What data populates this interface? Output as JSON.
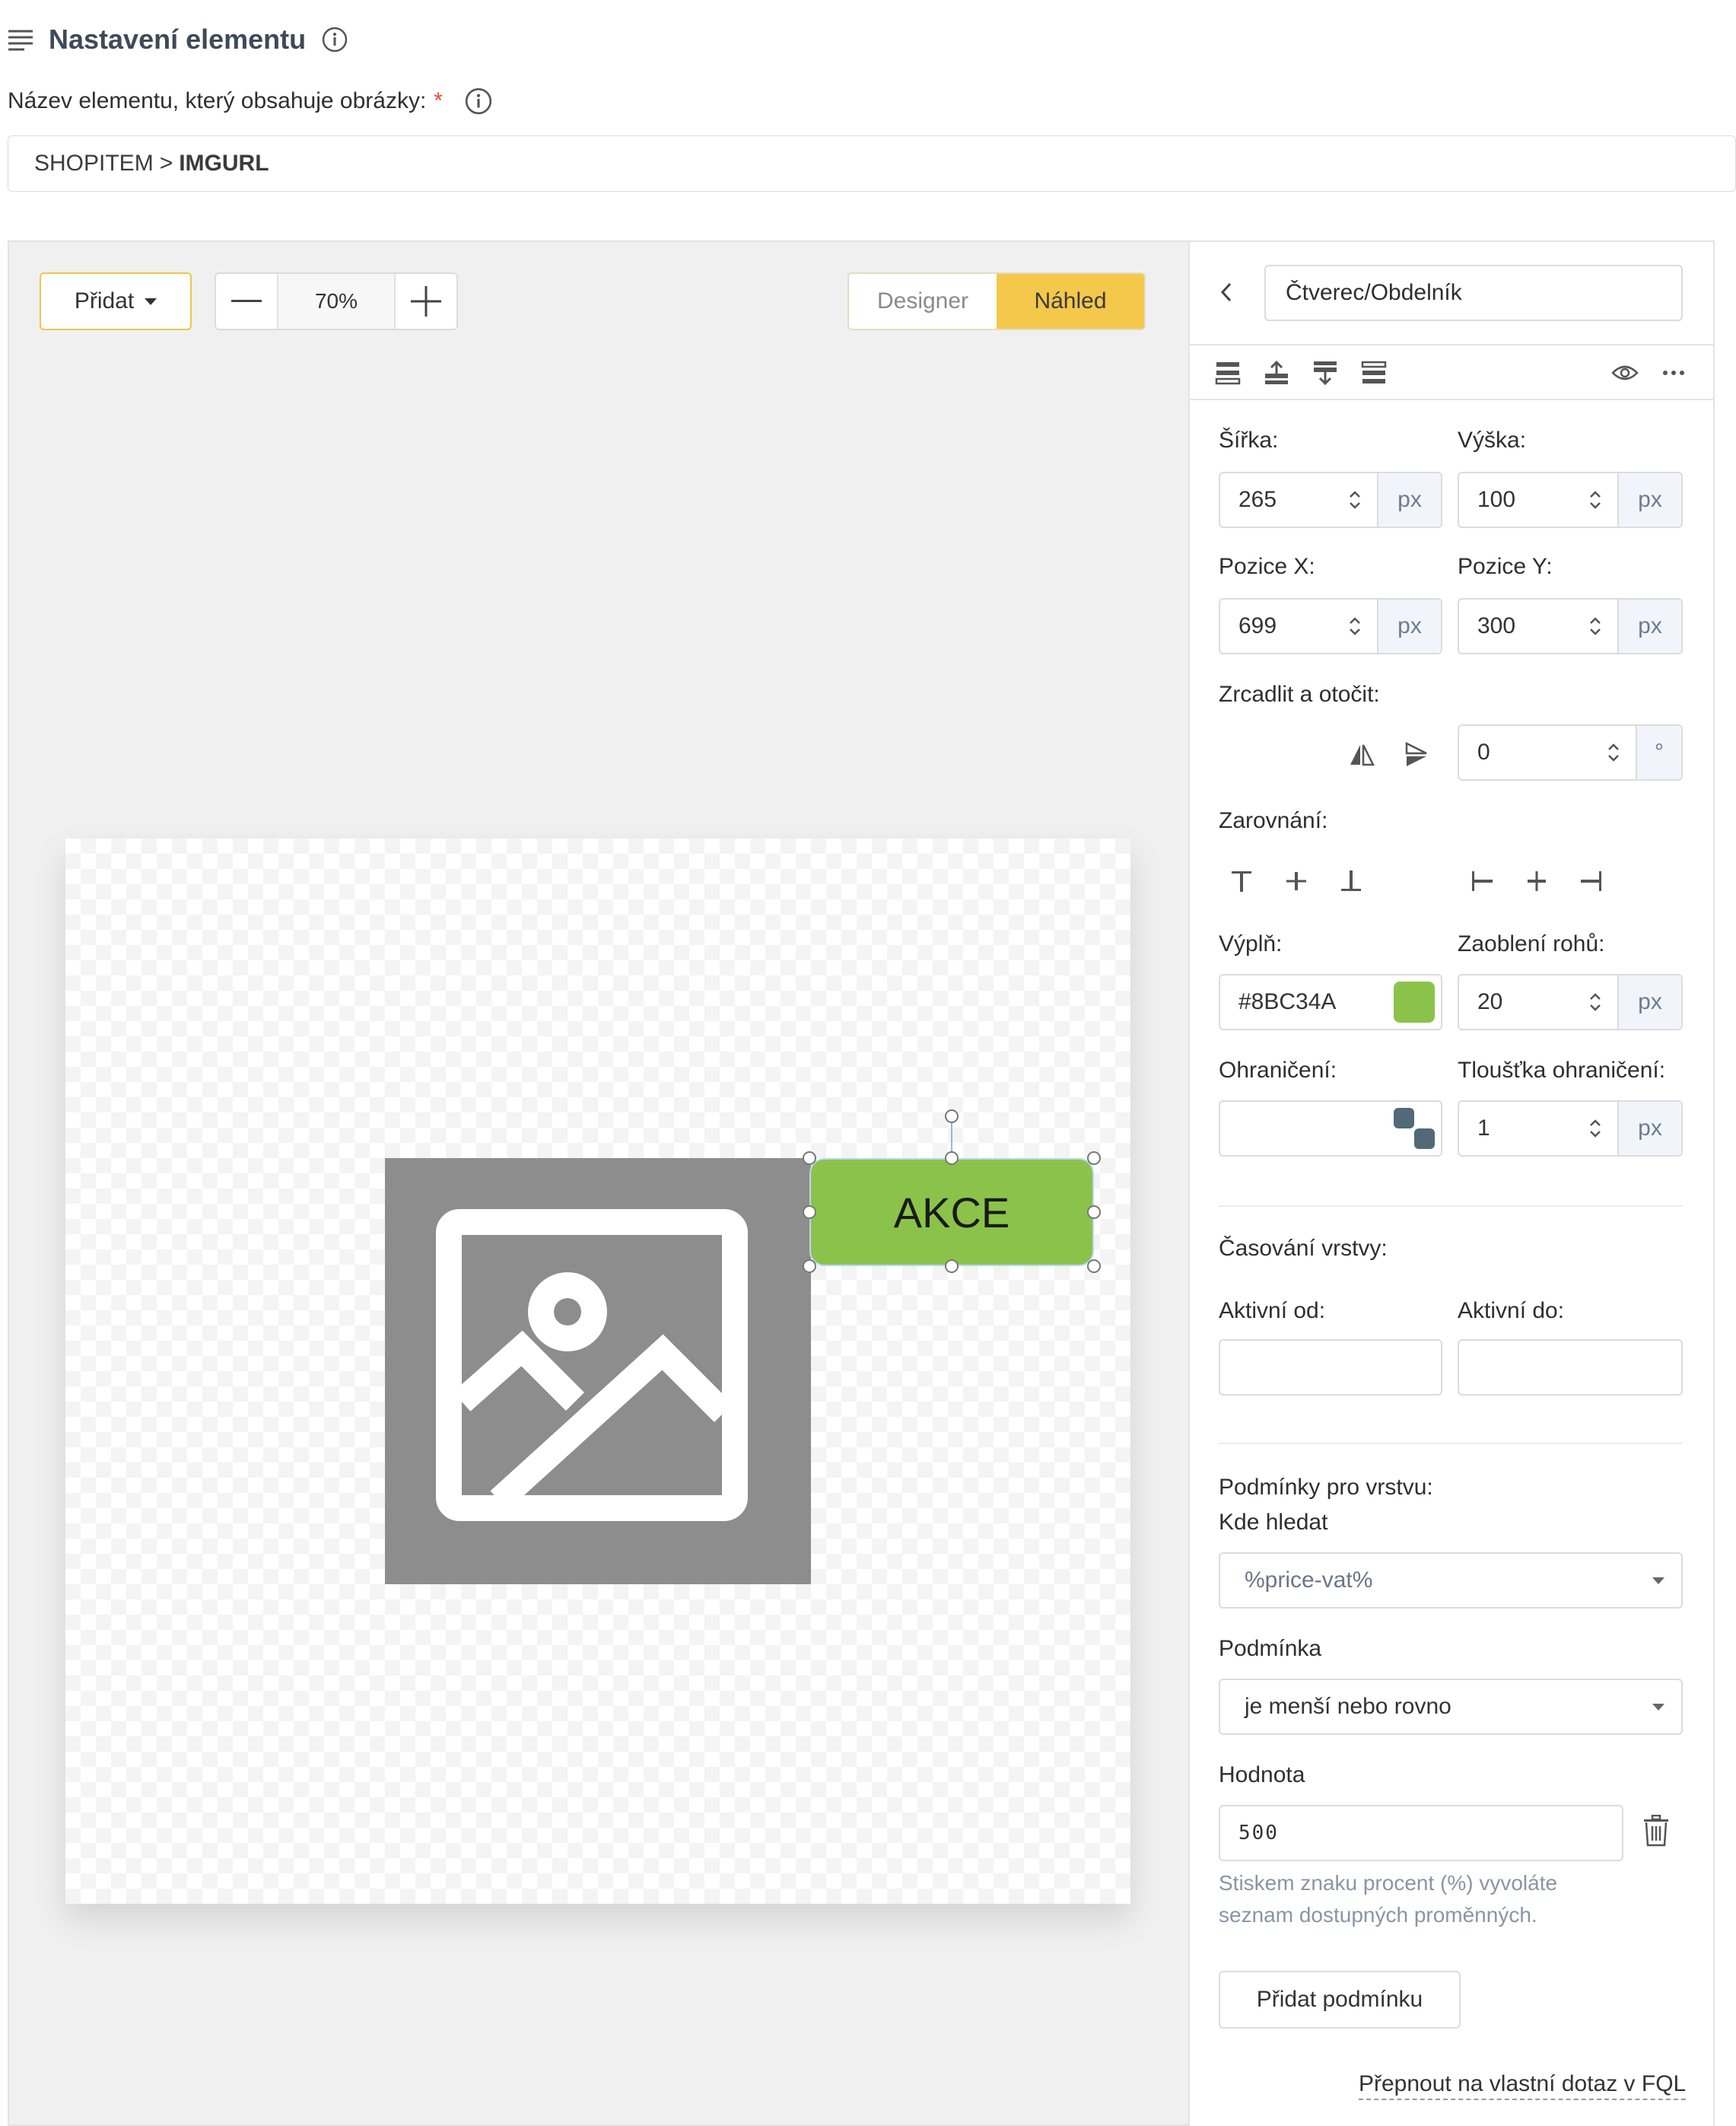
{
  "header": {
    "title": "Nastavení elementu",
    "field_label": "Název elementu, který obsahuje obrázky:",
    "required_mark": "*",
    "path_prefix": "SHOPITEM",
    "path_sep": ">",
    "path_value": "IMGURL"
  },
  "toolbar": {
    "add_label": "Přidat",
    "zoom_value": "70%",
    "mode_designer": "Designer",
    "mode_preview": "Náhled",
    "active_mode": "Náhled"
  },
  "canvas": {
    "button_text": "AKCE",
    "button_color": "#8BC34A",
    "placeholder_color": "#8D8D8D"
  },
  "panel": {
    "element_type": "Čtverec/Obdelník",
    "width_label": "Šířka:",
    "width_value": "265",
    "height_label": "Výška:",
    "height_value": "100",
    "posx_label": "Pozice X:",
    "posx_value": "699",
    "posy_label": "Pozice Y:",
    "posy_value": "300",
    "unit_px": "px",
    "unit_deg": "°",
    "mirror_label": "Zrcadlit a otočit:",
    "rotation_value": "0",
    "align_label": "Zarovnání:",
    "fill_label": "Výplň:",
    "fill_value": "#8BC34A",
    "radius_label": "Zaoblení rohů:",
    "radius_value": "20",
    "border_label": "Ohraničení:",
    "border_value": "",
    "border_width_label": "Tloušťka ohraničení:",
    "border_width_value": "1",
    "timing_title": "Časování vrstvy:",
    "active_from_label": "Aktivní od:",
    "active_from_value": "",
    "active_to_label": "Aktivní do:",
    "active_to_value": "",
    "conditions_title": "Podmínky pro vrstvu:",
    "where_label": "Kde hledat",
    "where_value": "%price-vat%",
    "condition_label": "Podmínka",
    "condition_value": "je menší nebo rovno",
    "value_label": "Hodnota",
    "value_value": "500",
    "hint_line1": "Stiskem znaku procent (%) vyvoláte",
    "hint_line2": "seznam dostupných proměnných.",
    "add_condition": "Přidat podmínku",
    "fql_link": "Přepnout na vlastní dotaz v FQL"
  }
}
